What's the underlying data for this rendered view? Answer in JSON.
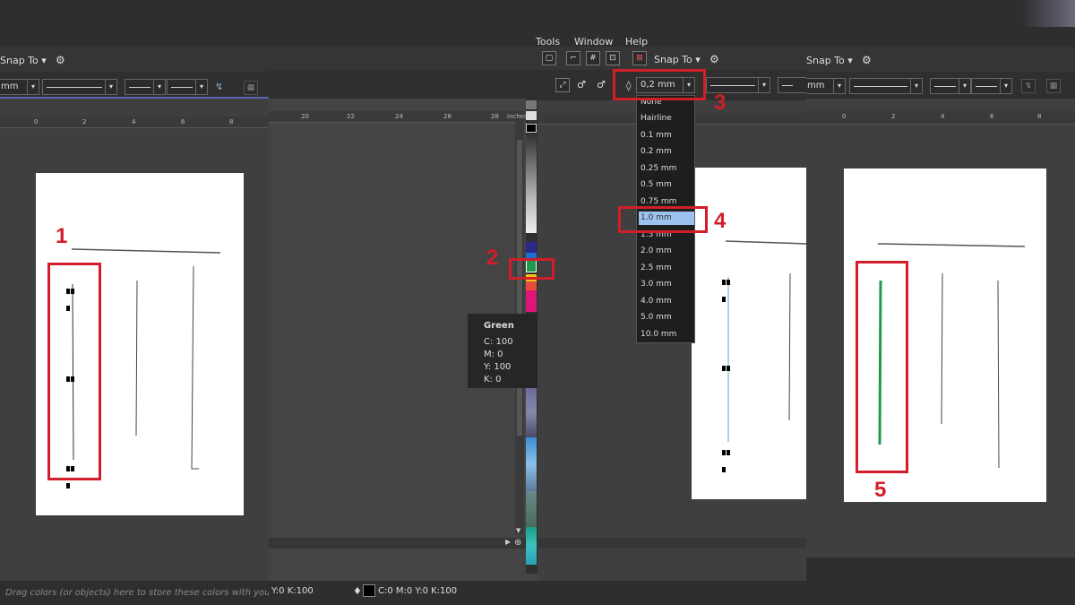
{
  "menu": {
    "items": [
      "Tools",
      "Window",
      "Help"
    ]
  },
  "snap_label": "Snap To",
  "unit_fragment": "mm",
  "outline_width_value": "0,2 mm",
  "width_options": [
    "None",
    "Hairline",
    "0.1 mm",
    "0.2 mm",
    "0.25 mm",
    "0.5 mm",
    "0.75 mm",
    "1.0 mm",
    "1.5 mm",
    "2.0 mm",
    "2.5 mm",
    "3.0 mm",
    "4.0 mm",
    "5.0 mm",
    "10.0 mm"
  ],
  "selected_width": "1.0 mm",
  "ruler_left": [
    "0",
    "2",
    "4",
    "6",
    "8"
  ],
  "ruler_mid": [
    "20",
    "22",
    "24",
    "26",
    "28"
  ],
  "ruler_mid_unit": "inches",
  "ruler_right": [
    "0",
    "2",
    "4",
    "6",
    "8"
  ],
  "tooltip": {
    "title": "Green",
    "lines": [
      "C: 100",
      "M: 0",
      "Y: 100",
      "K: 0"
    ]
  },
  "status": {
    "drag_hint": "Drag colors (or objects) here to store these colors with your do",
    "fill_readout": "Y:0 K:100",
    "outline_readout": "C:0 M:0 Y:0 K:100"
  },
  "steps": [
    "1",
    "2",
    "3",
    "4",
    "5"
  ],
  "colors": {
    "annotation": "#d11e2a",
    "green_line": "#1f9a4a",
    "selection_blue": "#9cc3f0"
  }
}
